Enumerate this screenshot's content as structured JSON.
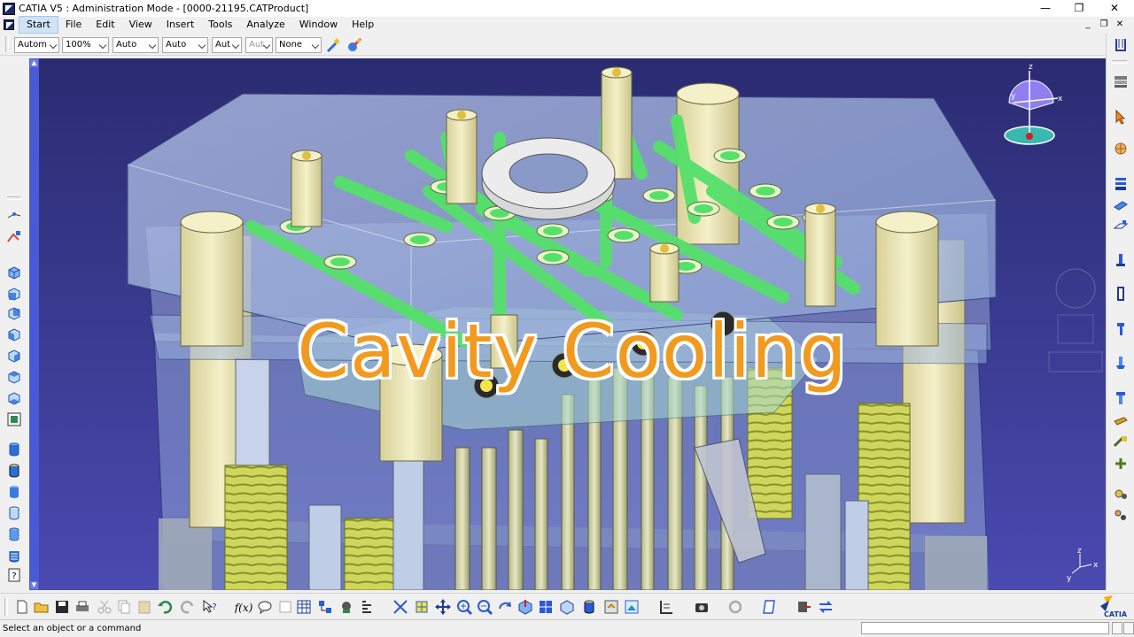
{
  "window": {
    "title": "CATIA V5 : Administration Mode - [0000-21195.CATProduct]",
    "controls": {
      "minimize": "—",
      "restore": "❐",
      "close": "✕"
    }
  },
  "menubar": {
    "items": [
      "Start",
      "File",
      "Edit",
      "View",
      "Insert",
      "Tools",
      "Analyze",
      "Window",
      "Help"
    ],
    "doc_controls": {
      "minimize": "_",
      "restore": "❐",
      "close": "✕"
    }
  },
  "toolbar": {
    "combos": [
      {
        "name": "graphic-mode-select",
        "value": "Autom",
        "disabled": false
      },
      {
        "name": "zoom-select",
        "value": "100%",
        "disabled": false
      },
      {
        "name": "color-select",
        "value": "Auto",
        "disabled": false
      },
      {
        "name": "linetype-select",
        "value": "Auto",
        "disabled": false
      },
      {
        "name": "thickness-select",
        "value": "Aut",
        "disabled": false
      },
      {
        "name": "point-select",
        "value": "Aut",
        "disabled": true
      },
      {
        "name": "layer-select",
        "value": "None",
        "disabled": false
      }
    ]
  },
  "viewport": {
    "overlay_title": "Cavity Cooling",
    "compass_axes": {
      "z": "z",
      "x": "x",
      "y": "y"
    },
    "mini_axes": {
      "z": "z",
      "x": "x",
      "y": "y"
    }
  },
  "status": {
    "message": "Select an object or a command",
    "brand": "CATIA"
  },
  "colors": {
    "viewport_bg": "#2e2e7a",
    "cooling_green": "#55e06a",
    "plate_transparent": "#9fb3d8",
    "fitting_cream": "#e8e3b4",
    "spring_yellow": "#d9e26a",
    "title_orange": "#f29a1e"
  },
  "icons": {
    "left": [
      "measure-icon",
      "analysis-icon",
      "view-iso-icon",
      "view-front-icon",
      "view-back-icon",
      "view-left-icon",
      "view-right-icon",
      "view-top-icon",
      "view-bottom-icon",
      "named-views-icon",
      "shading-icon",
      "shading-edges-icon",
      "shading-no-edges-icon",
      "wireframe-icon",
      "hidden-lines-icon",
      "custom-view-icon",
      "help-icon"
    ],
    "right": [
      "toolbar-grip-icon",
      "mold-base-icon",
      "select-icon",
      "catalog-icon",
      "plate-icon",
      "slider-icon",
      "core-icon",
      "ejector-pin-icon",
      "sprue-icon",
      "leader-pin-icon",
      "bushing-icon",
      "cooling-channel-icon",
      "fitting-icon",
      "drill-icon",
      "baffle-icon",
      "water-connector-icon"
    ],
    "bottom": [
      "new-icon",
      "open-icon",
      "save-icon",
      "print-icon",
      "cut-icon",
      "copy-icon",
      "paste-icon",
      "undo-icon",
      "redo-icon",
      "whats-this-icon",
      "formula-icon",
      "comment-icon",
      "knowledge-icon",
      "table-icon",
      "product-structure-icon",
      "catalog-browser-icon",
      "fly-mode-icon",
      "fit-all-icon",
      "pan-icon",
      "rotate-icon",
      "zoom-in-icon",
      "zoom-out-icon",
      "normal-view-icon",
      "quick-view-icon",
      "view-mode-icon",
      "hide-show-icon",
      "swap-visible-icon",
      "apply-material-icon",
      "clash-icon",
      "snapshot-icon",
      "update-icon",
      "sketch-icon",
      "publication-icon",
      "manipulate-icon"
    ]
  }
}
